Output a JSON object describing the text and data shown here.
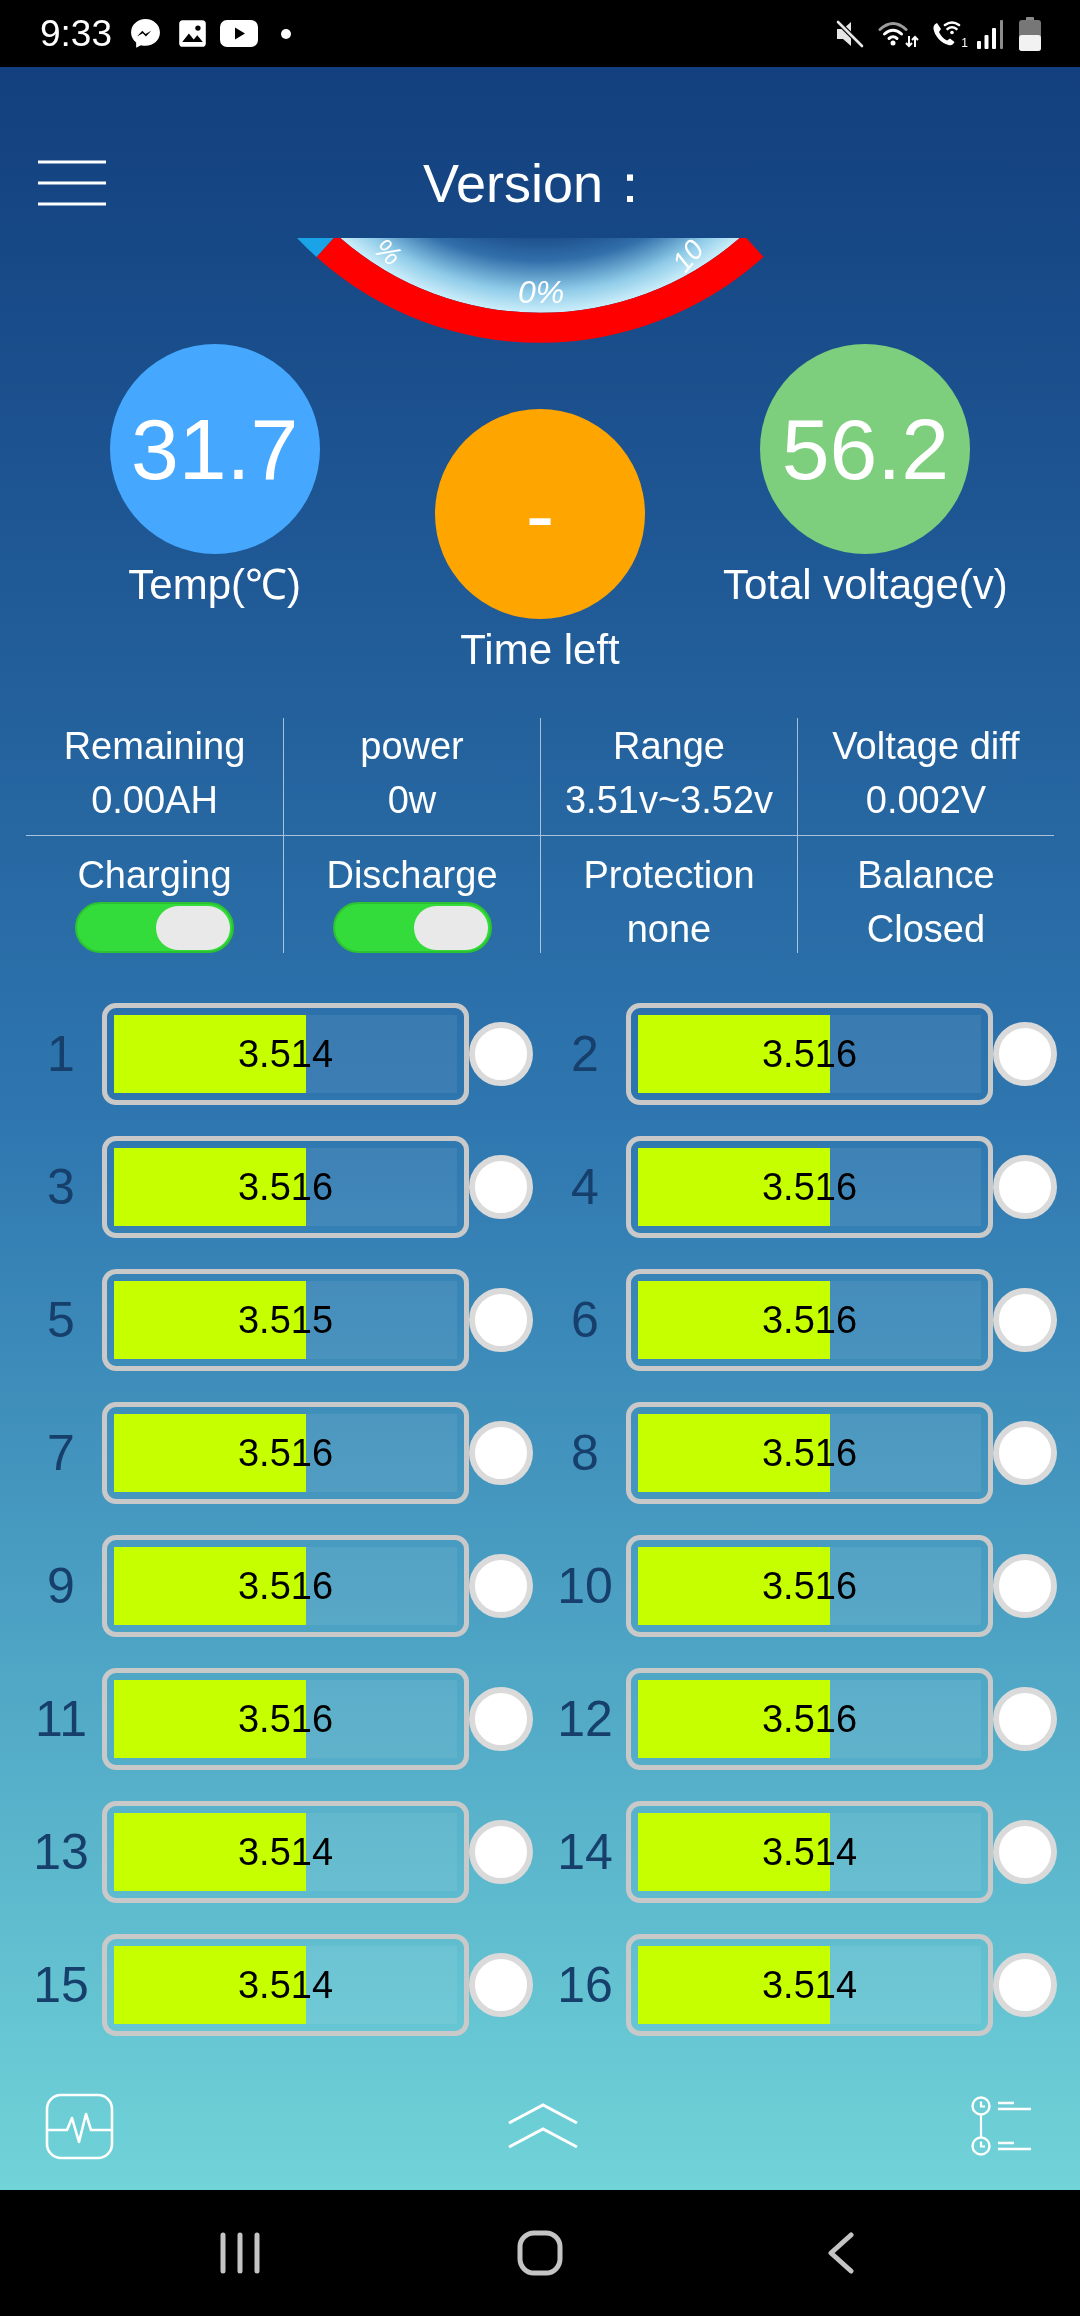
{
  "status_bar": {
    "time": "9:33",
    "sim_number": "1"
  },
  "header": {
    "title": "Version："
  },
  "gauge": {
    "reading": "0%",
    "scale_labels": [
      "%",
      "10"
    ]
  },
  "summary": [
    {
      "value": "31.7",
      "label": "Temp(℃)",
      "color": "#45a8fe"
    },
    {
      "value": "-",
      "label": "Time left",
      "color": "#ffa500"
    },
    {
      "value": "56.2",
      "label": "Total voltage(v)",
      "color": "#7dce7d"
    }
  ],
  "stat_rows": [
    [
      {
        "kind": "text",
        "label": "Remaining",
        "value": "0.00AH"
      },
      {
        "kind": "text",
        "label": "power",
        "value": "0w"
      },
      {
        "kind": "text",
        "label": "Range",
        "value": "3.51v~3.52v"
      },
      {
        "kind": "text",
        "label": "Voltage diff",
        "value": "0.002V"
      }
    ],
    [
      {
        "kind": "toggle",
        "label": "Charging",
        "on": true
      },
      {
        "kind": "toggle",
        "label": "Discharge",
        "on": true
      },
      {
        "kind": "text",
        "label": "Protection",
        "value": "none"
      },
      {
        "kind": "text",
        "label": "Balance",
        "value": "Closed"
      }
    ]
  ],
  "cells": [
    {
      "number": "1",
      "voltage": "3.514",
      "level": 0.56,
      "balancing": false
    },
    {
      "number": "2",
      "voltage": "3.516",
      "level": 0.56,
      "balancing": false
    },
    {
      "number": "3",
      "voltage": "3.516",
      "level": 0.56,
      "balancing": false
    },
    {
      "number": "4",
      "voltage": "3.516",
      "level": 0.56,
      "balancing": false
    },
    {
      "number": "5",
      "voltage": "3.515",
      "level": 0.56,
      "balancing": false
    },
    {
      "number": "6",
      "voltage": "3.516",
      "level": 0.56,
      "balancing": false
    },
    {
      "number": "7",
      "voltage": "3.516",
      "level": 0.56,
      "balancing": false
    },
    {
      "number": "8",
      "voltage": "3.516",
      "level": 0.56,
      "balancing": false
    },
    {
      "number": "9",
      "voltage": "3.516",
      "level": 0.56,
      "balancing": false
    },
    {
      "number": "10",
      "voltage": "3.516",
      "level": 0.56,
      "balancing": false
    },
    {
      "number": "11",
      "voltage": "3.516",
      "level": 0.56,
      "balancing": false
    },
    {
      "number": "12",
      "voltage": "3.516",
      "level": 0.56,
      "balancing": false
    },
    {
      "number": "13",
      "voltage": "3.514",
      "level": 0.56,
      "balancing": false
    },
    {
      "number": "14",
      "voltage": "3.514",
      "level": 0.56,
      "balancing": false
    },
    {
      "number": "15",
      "voltage": "3.514",
      "level": 0.56,
      "balancing": false
    },
    {
      "number": "16",
      "voltage": "3.514",
      "level": 0.56,
      "balancing": false
    }
  ]
}
